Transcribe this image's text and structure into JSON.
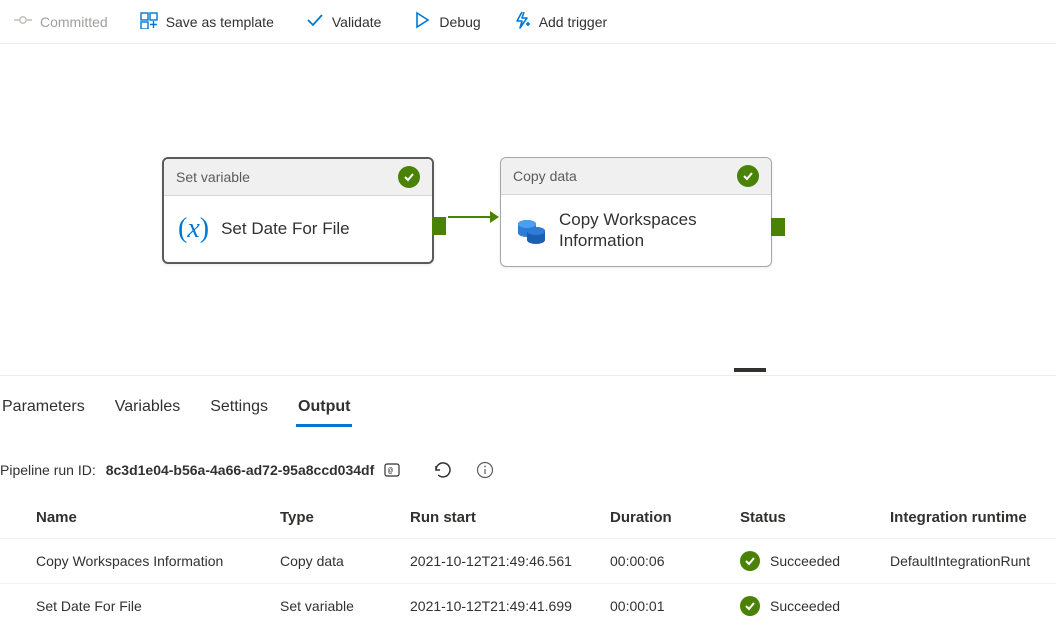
{
  "toolbar": {
    "committed": "Committed",
    "save_template": "Save as template",
    "validate": "Validate",
    "debug": "Debug",
    "add_trigger": "Add trigger"
  },
  "activities": [
    {
      "type_label": "Set variable",
      "name": "Set Date For File",
      "status": "succeeded",
      "icon": "variable"
    },
    {
      "type_label": "Copy data",
      "name": "Copy Workspaces Information",
      "status": "succeeded",
      "icon": "database"
    }
  ],
  "tabs": {
    "parameters": "Parameters",
    "variables": "Variables",
    "settings": "Settings",
    "output": "Output",
    "active": "output"
  },
  "run": {
    "label": "Pipeline run ID:",
    "id": "8c3d1e04-b56a-4a66-ad72-95a8ccd034df"
  },
  "table": {
    "headers": {
      "name": "Name",
      "type": "Type",
      "run_start": "Run start",
      "duration": "Duration",
      "status": "Status",
      "runtime": "Integration runtime"
    },
    "rows": [
      {
        "name": "Copy Workspaces Information",
        "type": "Copy data",
        "run_start": "2021-10-12T21:49:46.561",
        "duration": "00:00:06",
        "status": "Succeeded",
        "runtime": "DefaultIntegrationRunt"
      },
      {
        "name": "Set Date For File",
        "type": "Set variable",
        "run_start": "2021-10-12T21:49:41.699",
        "duration": "00:00:01",
        "status": "Succeeded",
        "runtime": ""
      }
    ]
  }
}
